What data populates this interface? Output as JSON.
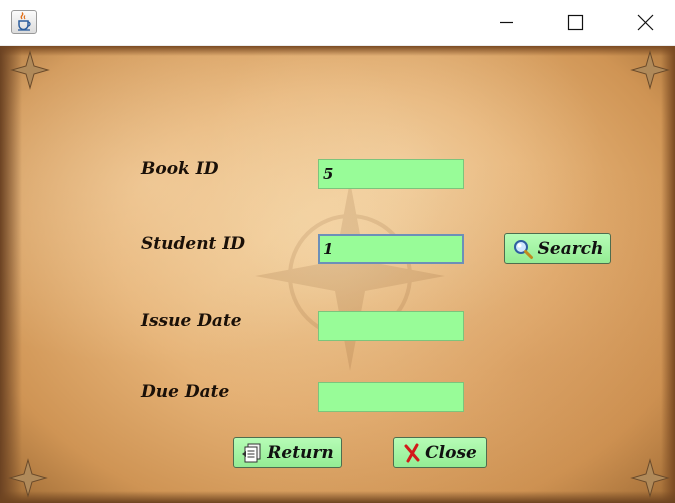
{
  "window": {
    "controls": {
      "minimize": "minimize-icon",
      "maximize": "maximize-icon",
      "close": "close-icon"
    },
    "app_icon": "java-cup-icon"
  },
  "form": {
    "book_id": {
      "label": "Book ID",
      "value": "5"
    },
    "student_id": {
      "label": "Student ID",
      "value": "1"
    },
    "issue_date": {
      "label": "Issue Date",
      "value": ""
    },
    "due_date": {
      "label": "Due Date",
      "value": ""
    }
  },
  "buttons": {
    "search": {
      "label": "Search",
      "icon": "magnifier-icon"
    },
    "return": {
      "label": "Return",
      "icon": "documents-icon"
    },
    "close": {
      "label": "Close",
      "icon": "red-x-icon"
    }
  },
  "colors": {
    "field_bg": "#98fc98",
    "button_bg": "#a6f5a6",
    "parchment": "#e6b377"
  }
}
